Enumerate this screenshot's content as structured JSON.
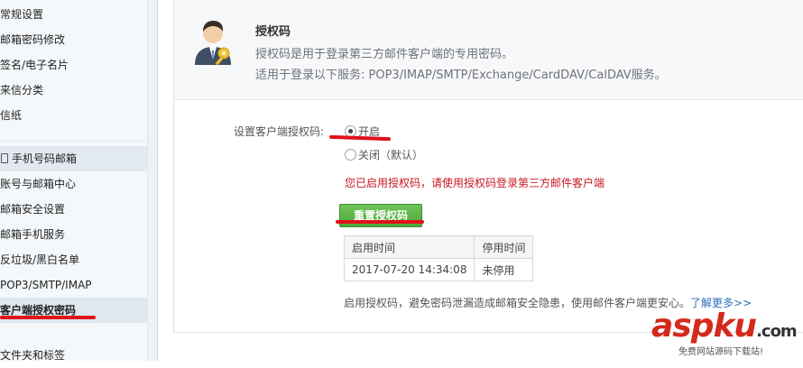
{
  "sidebar": {
    "items": [
      {
        "label": "常规设置"
      },
      {
        "label": "邮箱密码修改"
      },
      {
        "label": "签名/电子名片"
      },
      {
        "label": "来信分类"
      },
      {
        "label": "信纸"
      },
      {
        "label": "手机号码邮箱"
      },
      {
        "label": "账号与邮箱中心"
      },
      {
        "label": "邮箱安全设置"
      },
      {
        "label": "邮箱手机服务"
      },
      {
        "label": "反垃圾/黑白名单"
      },
      {
        "label": "POP3/SMTP/IMAP"
      },
      {
        "label": "客户端授权密码"
      },
      {
        "label": "文件夹和标签"
      }
    ]
  },
  "info": {
    "title": "授权码",
    "desc1": "授权码是用于登录第三方邮件客户端的专用密码。",
    "desc2": "适用于登录以下服务: POP3/IMAP/SMTP/Exchange/CardDAV/CalDAV服务。"
  },
  "setting": {
    "label": "设置客户端授权码:",
    "option_on": "开启",
    "option_off": "关闭（默认）",
    "selected": "开启"
  },
  "status_message": "您已启用授权码，请使用授权码登录第三方邮件客户端",
  "reset_button": "重置授权码",
  "history_table": {
    "headers": [
      "启用时间",
      "停用时间"
    ],
    "rows": [
      [
        "2017-07-20 14:34:08",
        "未停用"
      ]
    ]
  },
  "footer": {
    "note": "启用授权码，避免密码泄漏造成邮箱安全隐患，使用邮件客户端更安心。",
    "link": "了解更多>>"
  },
  "watermark": {
    "brand": "aspku",
    "suffix": ".com",
    "subtitle": "免费网站源码下载站!"
  },
  "colors": {
    "accent_red": "#e3101a",
    "button_green": "#4ea83a",
    "link_blue": "#2a6fbd",
    "status_red": "#c81623"
  }
}
